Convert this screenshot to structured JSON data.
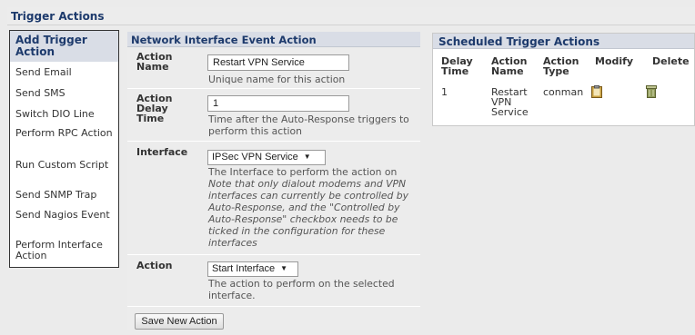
{
  "page": {
    "title": "Trigger Actions"
  },
  "sidebar": {
    "header": "Add Trigger Action",
    "items": [
      {
        "label": "Send Email"
      },
      {
        "label": "Send SMS"
      },
      {
        "label": "Switch DIO Line"
      },
      {
        "label": "Perform RPC Action"
      },
      {
        "label": "Run Custom Script"
      },
      {
        "label": "Send SNMP Trap"
      },
      {
        "label": "Send Nagios Event"
      },
      {
        "label": "Perform Interface Action"
      }
    ]
  },
  "form": {
    "title": "Network Interface Event Action",
    "action_name": {
      "label": "Action Name",
      "value": "Restart VPN Service",
      "help": "Unique name for this action"
    },
    "action_delay_time": {
      "label": "Action Delay Time",
      "value": "1",
      "help": "Time after the Auto-Response triggers to perform this action"
    },
    "interface": {
      "label": "Interface",
      "selected": "IPSec VPN Service",
      "help": "The Interface to perform the action on",
      "note": "Note that only dialout modems and VPN interfaces can currently be controlled by Auto-Response, and the \"Controlled by Auto-Response\" checkbox needs to be ticked in the configuration for these interfaces"
    },
    "action": {
      "label": "Action",
      "selected": "Start Interface",
      "help": "The action to perform on the selected interface."
    },
    "save_label": "Save New Action"
  },
  "scheduled": {
    "title": "Scheduled Trigger Actions",
    "columns": [
      "Delay Time",
      "Action Name",
      "Action Type",
      "Modify",
      "Delete"
    ],
    "rows": [
      {
        "delay": "1",
        "name": "Restart VPN Service",
        "type": "conman"
      }
    ]
  },
  "colors": {
    "accent": "#1d3a6c",
    "panel_header": "#d9dde6",
    "modify_icon": "#c8a040",
    "delete_icon": "#8f9a5a"
  }
}
